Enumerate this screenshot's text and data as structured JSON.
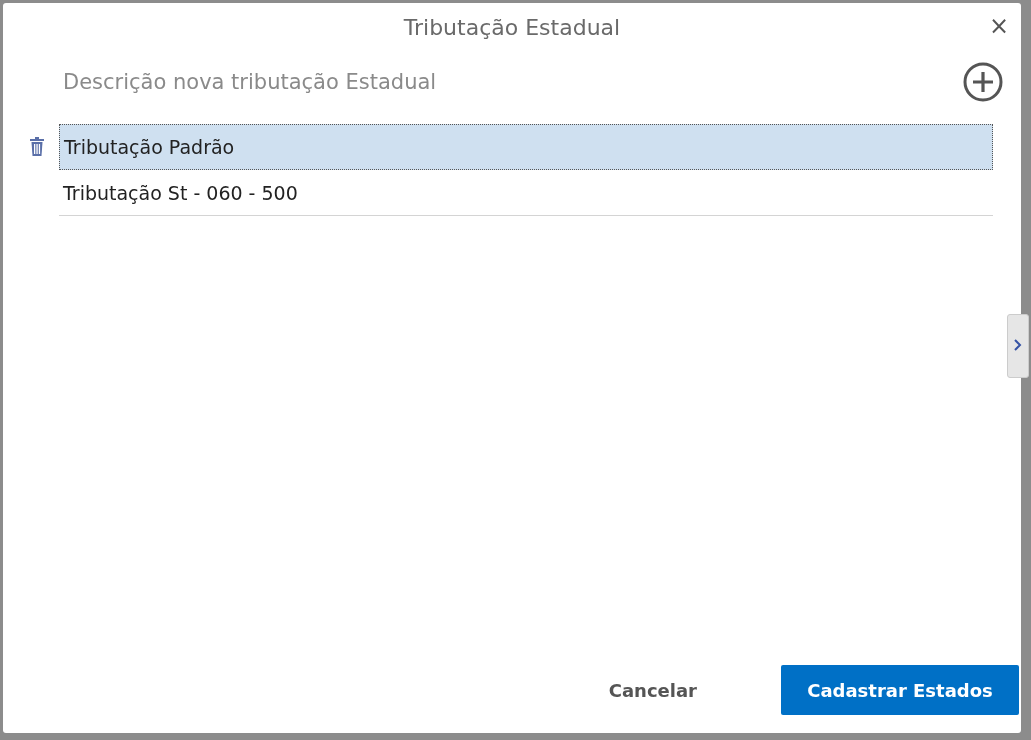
{
  "dialog": {
    "title": "Tributação Estadual",
    "close": "×"
  },
  "field": {
    "placeholder": "Descrição nova tributação Estadual"
  },
  "items": [
    {
      "label": "Tributação Padrão",
      "selected": true
    },
    {
      "label": "Tributação St - 060 - 500",
      "selected": false
    }
  ],
  "buttons": [
    {
      "label": "Cancelar",
      "kind": "secondary"
    },
    {
      "label": "Cadastrar Estados",
      "kind": "primary"
    }
  ]
}
